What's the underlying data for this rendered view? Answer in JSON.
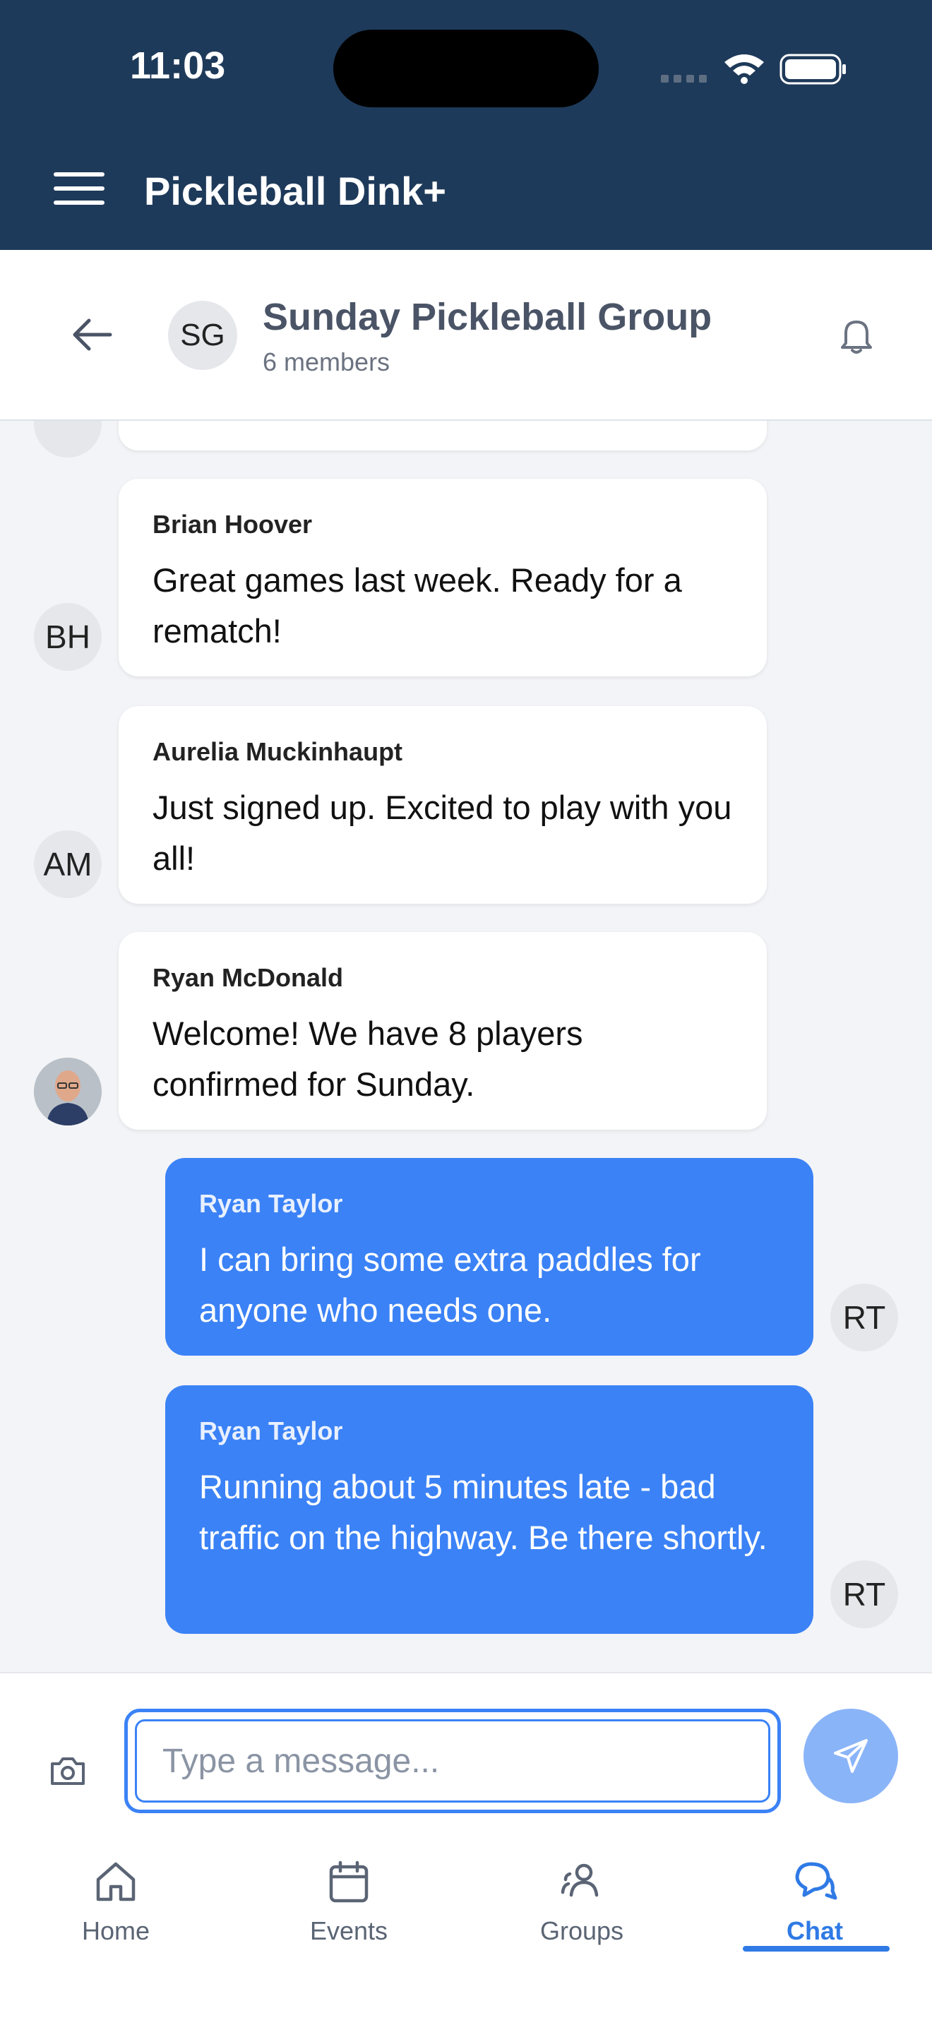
{
  "status_bar": {
    "time": "11:03"
  },
  "app": {
    "title": "Pickleball Dink+"
  },
  "chat": {
    "group_initials": "SG",
    "group_name": "Sunday Pickleball Group",
    "member_count": "6 members"
  },
  "messages": [
    {
      "sender": "Brian Hoover",
      "text": "Great games last week. Ready for a rematch!",
      "initials": "BH",
      "mine": false
    },
    {
      "sender": "Aurelia Muckinhaupt",
      "text": "Just signed up. Excited to play with you all!",
      "initials": "AM",
      "mine": false
    },
    {
      "sender": "Ryan McDonald",
      "text": "Welcome! We have 8 players confirmed for Sunday.",
      "initials": "",
      "mine": false
    },
    {
      "sender": "Ryan Taylor",
      "text": "I can bring some extra paddles for anyone who needs one.",
      "initials": "RT",
      "mine": true
    },
    {
      "sender": "Ryan Taylor",
      "text": "Running about 5 minutes late - bad traffic on the highway. Be there shortly.",
      "initials": "RT",
      "mine": true
    }
  ],
  "composer": {
    "placeholder": "Type a message..."
  },
  "nav": [
    {
      "label": "Home",
      "icon": "home-icon"
    },
    {
      "label": "Events",
      "icon": "calendar-icon"
    },
    {
      "label": "Groups",
      "icon": "users-icon"
    },
    {
      "label": "Chat",
      "icon": "chat-icon",
      "active": true
    }
  ],
  "colors": {
    "header": "#1e3a5a",
    "accent": "#3b82f6",
    "nav_active": "#2f7ae5"
  }
}
